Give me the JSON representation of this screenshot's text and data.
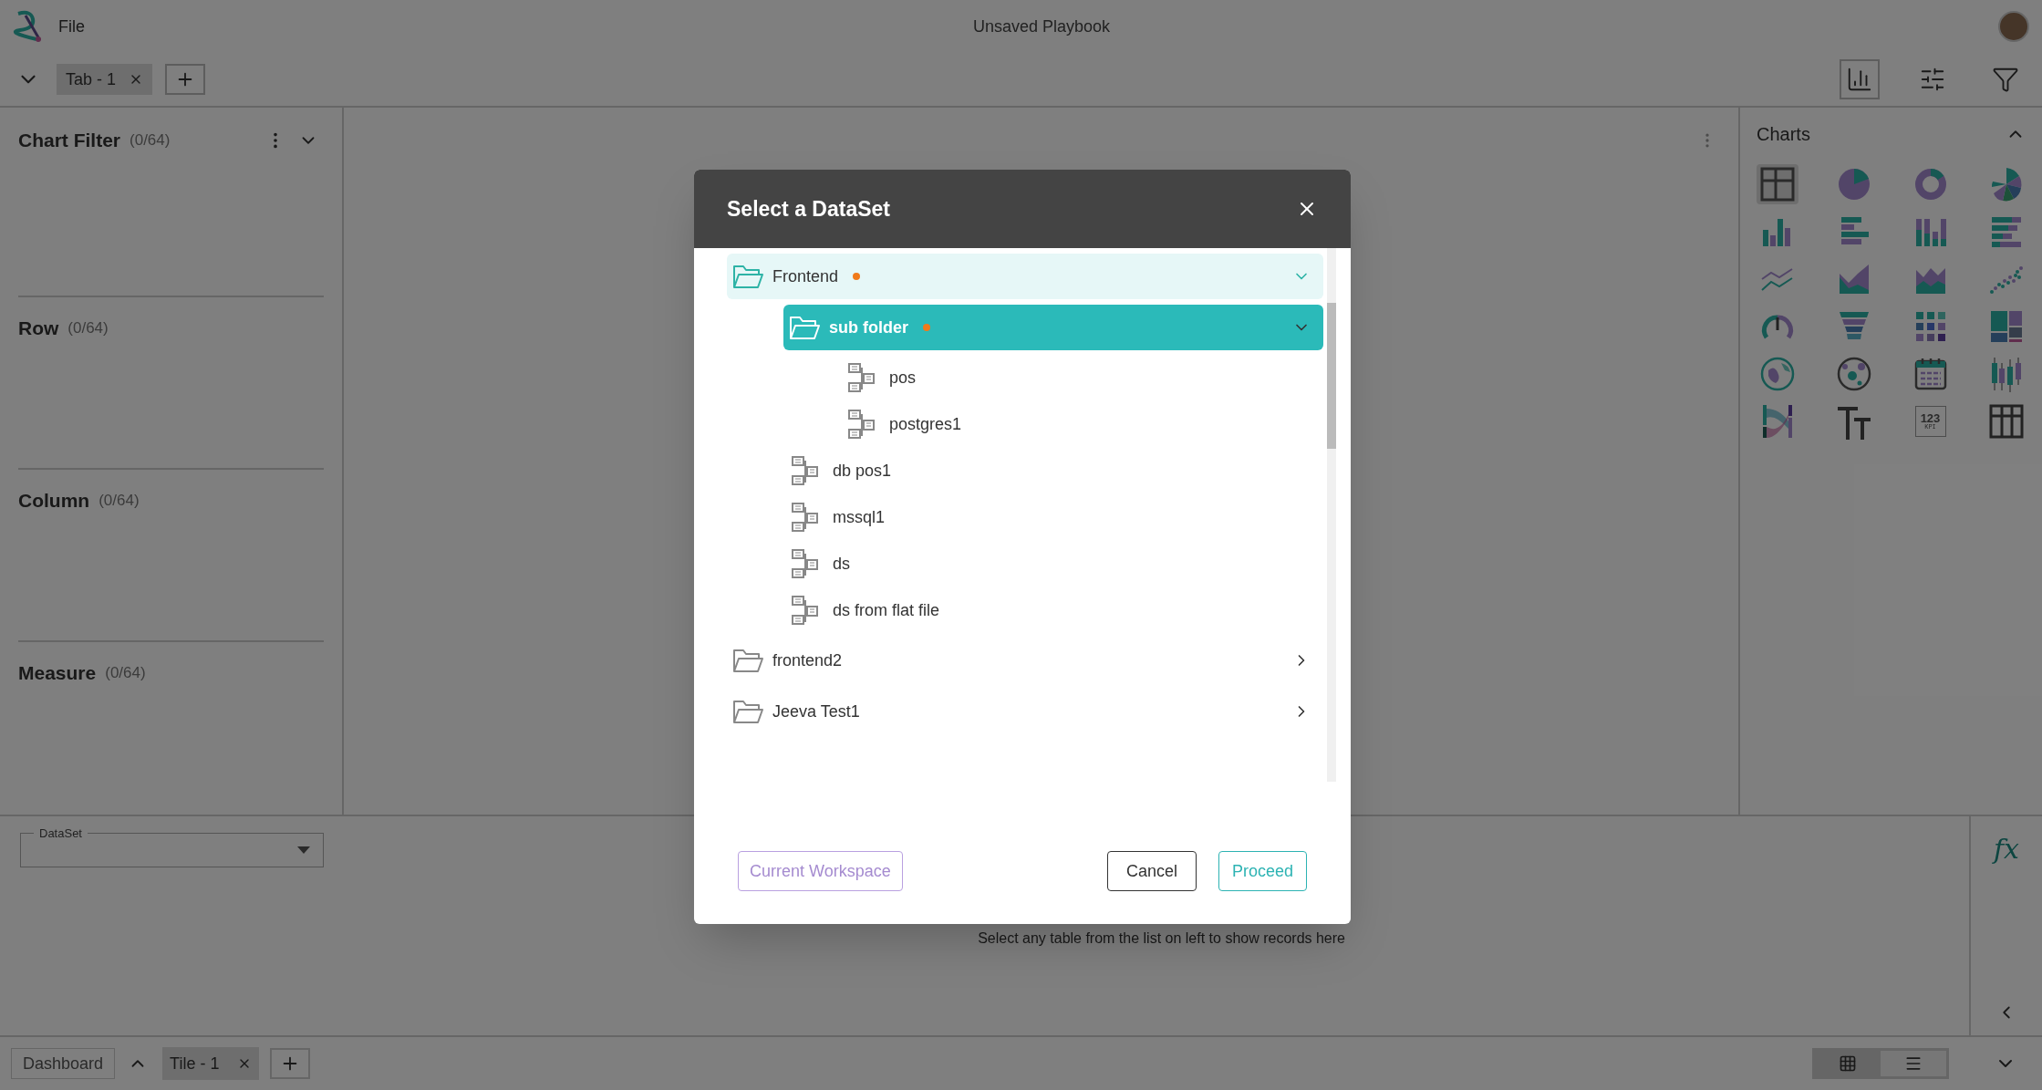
{
  "app": {
    "menu": "File",
    "title": "Unsaved Playbook"
  },
  "tabs": [
    {
      "label": "Tab - 1",
      "selected": true
    }
  ],
  "toolbar": [
    {
      "kind": "charts",
      "selected": true
    },
    {
      "kind": "settings",
      "selected": false
    },
    {
      "kind": "filter",
      "selected": false
    }
  ],
  "left_panel": {
    "sections": [
      {
        "title": "Chart Filter",
        "count": "(0/64)"
      },
      {
        "title": "Row",
        "count": "(0/64)"
      },
      {
        "title": "Column",
        "count": "(0/64)"
      },
      {
        "title": "Measure",
        "count": "(0/64)"
      }
    ]
  },
  "charts_panel": {
    "title": "Charts",
    "expanded": true,
    "charts": [
      {
        "kind": "table",
        "selected": true
      },
      {
        "kind": "pie",
        "selected": false
      },
      {
        "kind": "donut",
        "selected": false
      },
      {
        "kind": "rose",
        "selected": false
      },
      {
        "kind": "bar",
        "selected": false
      },
      {
        "kind": "hbar",
        "selected": false
      },
      {
        "kind": "stackedbar",
        "selected": false
      },
      {
        "kind": "stackedhbar",
        "selected": false
      },
      {
        "kind": "line",
        "selected": false
      },
      {
        "kind": "area",
        "selected": false
      },
      {
        "kind": "stackedarea",
        "selected": false
      },
      {
        "kind": "scatter",
        "selected": false
      },
      {
        "kind": "gauge",
        "selected": false
      },
      {
        "kind": "funnel",
        "selected": false
      },
      {
        "kind": "heatmap",
        "selected": false
      },
      {
        "kind": "treemap",
        "selected": false
      },
      {
        "kind": "map",
        "selected": false
      },
      {
        "kind": "bubblemap",
        "selected": false
      },
      {
        "kind": "calendar",
        "selected": false
      },
      {
        "kind": "candlestick",
        "selected": false
      },
      {
        "kind": "sankey",
        "selected": false
      },
      {
        "kind": "text",
        "selected": false
      },
      {
        "kind": "kpi",
        "selected": false,
        "number": "123",
        "caption": "KPI"
      },
      {
        "kind": "grid",
        "selected": false
      }
    ]
  },
  "dataset_field": {
    "label": "DataSet"
  },
  "formula_button": "fx",
  "records_hint": "Select any table from the list on left to show records here",
  "bottom_bar": {
    "dashboard": "Dashboard",
    "tiles": [
      {
        "label": "Tile - 1",
        "selected": true
      }
    ],
    "views": [
      {
        "kind": "grid",
        "selected": false
      },
      {
        "kind": "list",
        "selected": true
      }
    ]
  },
  "dialog": {
    "title": "Select a DataSet",
    "tree": [
      {
        "kind": "folder",
        "label": "Frontend",
        "expanded": true,
        "selected": false,
        "modified": true,
        "children": [
          {
            "kind": "folder",
            "label": "sub folder",
            "expanded": true,
            "selected": true,
            "modified": true,
            "children": [
              {
                "kind": "dataset",
                "label": "pos",
                "selected": false
              },
              {
                "kind": "dataset",
                "label": "postgres1",
                "selected": false
              }
            ]
          },
          {
            "kind": "dataset",
            "label": "db pos1",
            "selected": false
          },
          {
            "kind": "dataset",
            "label": "mssql1",
            "selected": false
          },
          {
            "kind": "dataset",
            "label": "ds",
            "selected": false
          },
          {
            "kind": "dataset",
            "label": "ds from flat file",
            "selected": false
          }
        ]
      },
      {
        "kind": "folder",
        "label": "frontend2",
        "expanded": false,
        "selected": false,
        "modified": false
      },
      {
        "kind": "folder",
        "label": "Jeeva Test1",
        "expanded": false,
        "selected": false,
        "modified": false
      }
    ],
    "buttons": {
      "workspace": "Current Workspace",
      "cancel": "Cancel",
      "proceed": "Proceed"
    }
  }
}
